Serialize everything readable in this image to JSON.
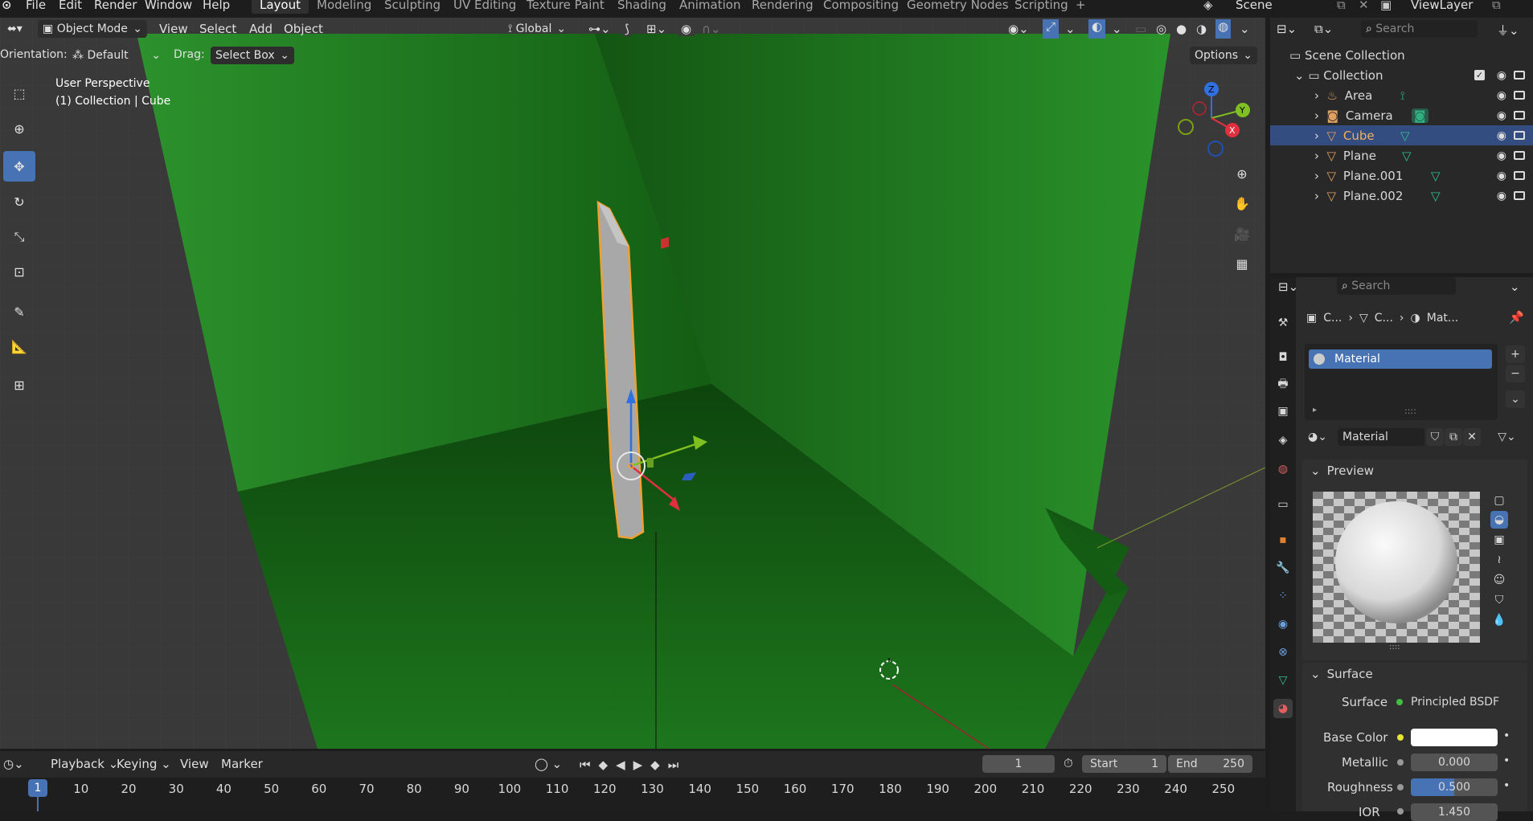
{
  "menu": {
    "file": "File",
    "edit": "Edit",
    "render": "Render",
    "window": "Window",
    "help": "Help"
  },
  "workspaces": [
    "Layout",
    "Modeling",
    "Sculpting",
    "UV Editing",
    "Texture Paint",
    "Shading",
    "Animation",
    "Rendering",
    "Compositing",
    "Geometry Nodes",
    "Scripting"
  ],
  "active_workspace": "Layout",
  "scene": "Scene",
  "view_layer": "ViewLayer",
  "viewport": {
    "mode": "Object Mode",
    "menus": [
      "View",
      "Select",
      "Add",
      "Object"
    ],
    "transform_orientation": "Global",
    "orientation_label": "Orientation:",
    "orientation_value": "Default",
    "drag_label": "Drag:",
    "drag_value": "Select Box",
    "options": "Options",
    "overlay_title": "User Perspective",
    "overlay_sub": "(1) Collection | Cube",
    "gizmo_x": "X",
    "gizmo_y": "Y",
    "gizmo_z": "Z",
    "colors": {
      "background": "#393939",
      "floor": "#1f6e1f",
      "wall": "#2a8a2a",
      "selection": "#f0a030",
      "x_axis": "#e03040",
      "y_axis": "#80c020",
      "z_axis": "#3070e0"
    }
  },
  "outliner": {
    "search_placeholder": "Search",
    "scene_collection": "Scene Collection",
    "collection": "Collection",
    "items": [
      {
        "name": "Area",
        "icon": "light-icon",
        "selected": false
      },
      {
        "name": "Camera",
        "icon": "camera-icon",
        "selected": false
      },
      {
        "name": "Cube",
        "icon": "mesh-icon",
        "selected": true
      },
      {
        "name": "Plane",
        "icon": "mesh-icon",
        "selected": false
      },
      {
        "name": "Plane.001",
        "icon": "mesh-icon",
        "selected": false
      },
      {
        "name": "Plane.002",
        "icon": "mesh-icon",
        "selected": false
      }
    ]
  },
  "properties": {
    "search_placeholder": "Search",
    "breadcrumb": [
      "C...",
      "C...",
      "Mat..."
    ],
    "material_slot": "Material",
    "material_name": "Material",
    "preview_title": "Preview",
    "surface_title": "Surface",
    "surface_label": "Surface",
    "surface_value": "Principled BSDF",
    "base_color_label": "Base Color",
    "base_color": "#ffffff",
    "metallic_label": "Metallic",
    "metallic_value": "0.000",
    "roughness_label": "Roughness",
    "roughness_value": "0.500",
    "roughness_fraction": 0.5,
    "ior_label": "IOR",
    "ior_value": "1.450"
  },
  "timeline": {
    "menus": [
      "Playback",
      "Keying",
      "View",
      "Marker"
    ],
    "current_frame": "1",
    "start_label": "Start",
    "start_value": "1",
    "end_label": "End",
    "end_value": "250",
    "ticks": [
      "1",
      "10",
      "20",
      "30",
      "40",
      "50",
      "60",
      "70",
      "80",
      "90",
      "100",
      "110",
      "120",
      "130",
      "140",
      "150",
      "160",
      "170",
      "180",
      "190",
      "200",
      "210",
      "220",
      "230",
      "240",
      "250"
    ]
  }
}
